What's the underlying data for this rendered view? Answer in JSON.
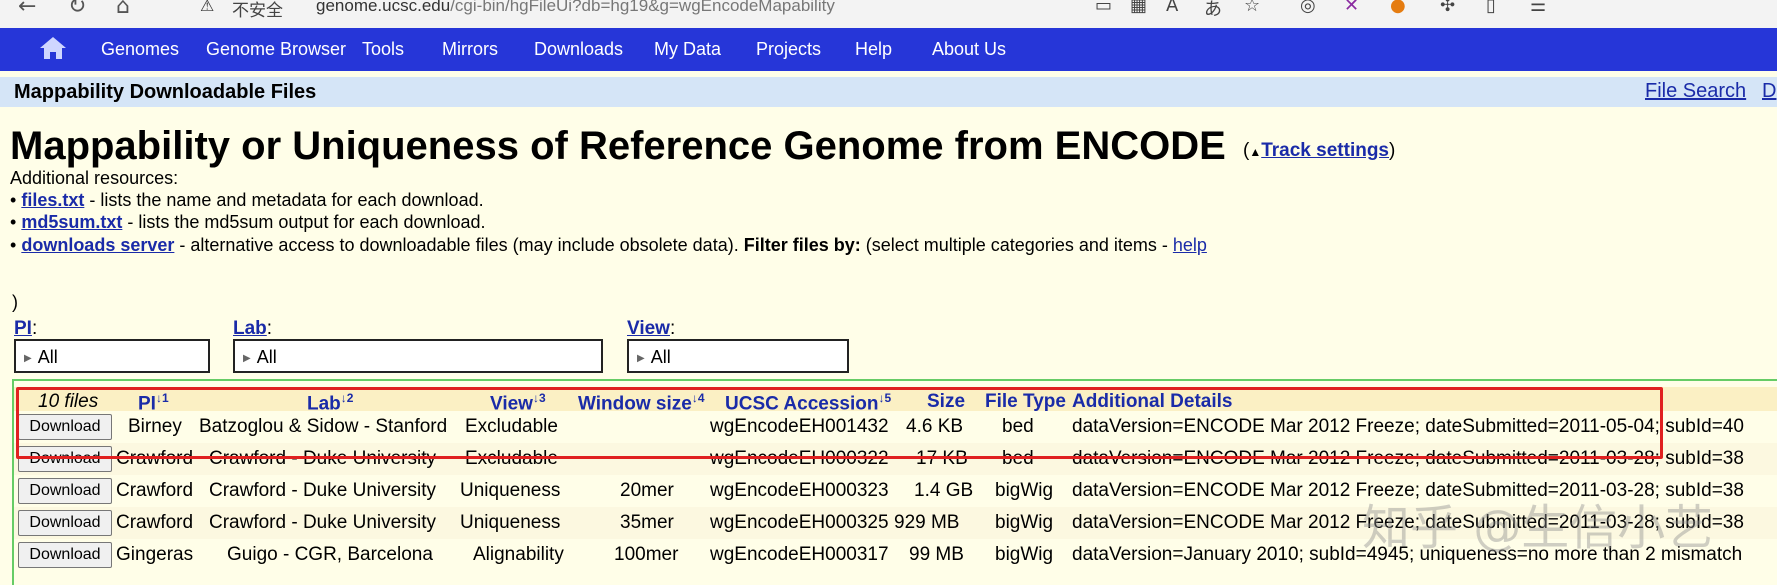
{
  "browser": {
    "insecure_label": "不安全",
    "url_host": "genome.ucsc.edu",
    "url_path": "/cgi-bin/hgFileUi?db=hg19&g=wgEncodeMapability"
  },
  "nav": {
    "items": [
      "Genomes",
      "Genome Browser",
      "Tools",
      "Mirrors",
      "Downloads",
      "My Data",
      "Projects",
      "Help",
      "About Us"
    ]
  },
  "titlebar": {
    "title": "Mappability Downloadable Files",
    "file_search": "File Search",
    "d_link": "D"
  },
  "heading": {
    "title": "Mappability or Uniqueness of Reference Genome from ENCODE",
    "track_settings_open": "(",
    "track_settings": "Track settings",
    "track_settings_close": ")"
  },
  "resources": {
    "intro": "Additional resources:",
    "bullet": "•",
    "files_link": "files.txt",
    "files_desc": " - lists the name and metadata for each download.",
    "md5_link": "md5sum.txt",
    "md5_desc": " - lists the md5sum output for each download.",
    "server_link": "downloads server",
    "server_desc": " - alternative access to downloadable files (may include obsolete data). ",
    "filter_label": "Filter files by:",
    "filter_desc": " (select multiple categories and items - ",
    "help_link": "help",
    "paren_close": ")"
  },
  "filters": {
    "pi_label": "PI",
    "pi_value": "All",
    "lab_label": "Lab",
    "lab_value": "All",
    "view_label": "View",
    "view_value": "All",
    "colon": ":"
  },
  "table": {
    "count": "10 files",
    "headers": {
      "pi": "PI",
      "pi_sort": "↓1",
      "lab": "Lab",
      "lab_sort": "↓2",
      "view": "View",
      "view_sort": "↓3",
      "window": "Window size",
      "window_sort": "↓4",
      "accession": "UCSC Accession",
      "accession_sort": "↓5",
      "size": "Size",
      "filetype": "File Type",
      "details": "Additional Details"
    },
    "download_label": "Download",
    "rows": [
      {
        "pi": "Birney",
        "lab": "Batzoglou & Sidow - Stanford",
        "view": "Excludable",
        "window": "",
        "acc": "wgEncodeEH001432",
        "size": "4.6 KB",
        "type": "bed",
        "details": "dataVersion=ENCODE Mar 2012 Freeze; dateSubmitted=2011-05-04; subId=40"
      },
      {
        "pi": "Crawford",
        "lab": "Crawford - Duke University",
        "view": "Excludable",
        "window": "",
        "acc": "wgEncodeEH000322",
        "size": "17 KB",
        "type": "bed",
        "details": "dataVersion=ENCODE Mar 2012 Freeze; dateSubmitted=2011-03-28; subId=38"
      },
      {
        "pi": "Crawford",
        "lab": "Crawford - Duke University",
        "view": "Uniqueness",
        "window": "20mer",
        "acc": "wgEncodeEH000323",
        "size": "1.4 GB",
        "type": "bigWig",
        "details": "dataVersion=ENCODE Mar 2012 Freeze; dateSubmitted=2011-03-28; subId=38"
      },
      {
        "pi": "Crawford",
        "lab": "Crawford - Duke University",
        "view": "Uniqueness",
        "window": "35mer",
        "acc": "wgEncodeEH000325",
        "size": "929 MB",
        "type": "bigWig",
        "details": "dataVersion=ENCODE Mar 2012 Freeze; dateSubmitted=2011-03-28; subId=38"
      },
      {
        "pi": "Gingeras",
        "lab": "Guigo - CGR, Barcelona",
        "view": "Alignability",
        "window": "100mer",
        "acc": "wgEncodeEH000317",
        "size": "99 MB",
        "type": "bigWig",
        "details": "dataVersion=January 2010; subId=4945; uniqueness=no more than 2 mismatch"
      }
    ]
  },
  "watermark": "知乎 @生信小艺"
}
